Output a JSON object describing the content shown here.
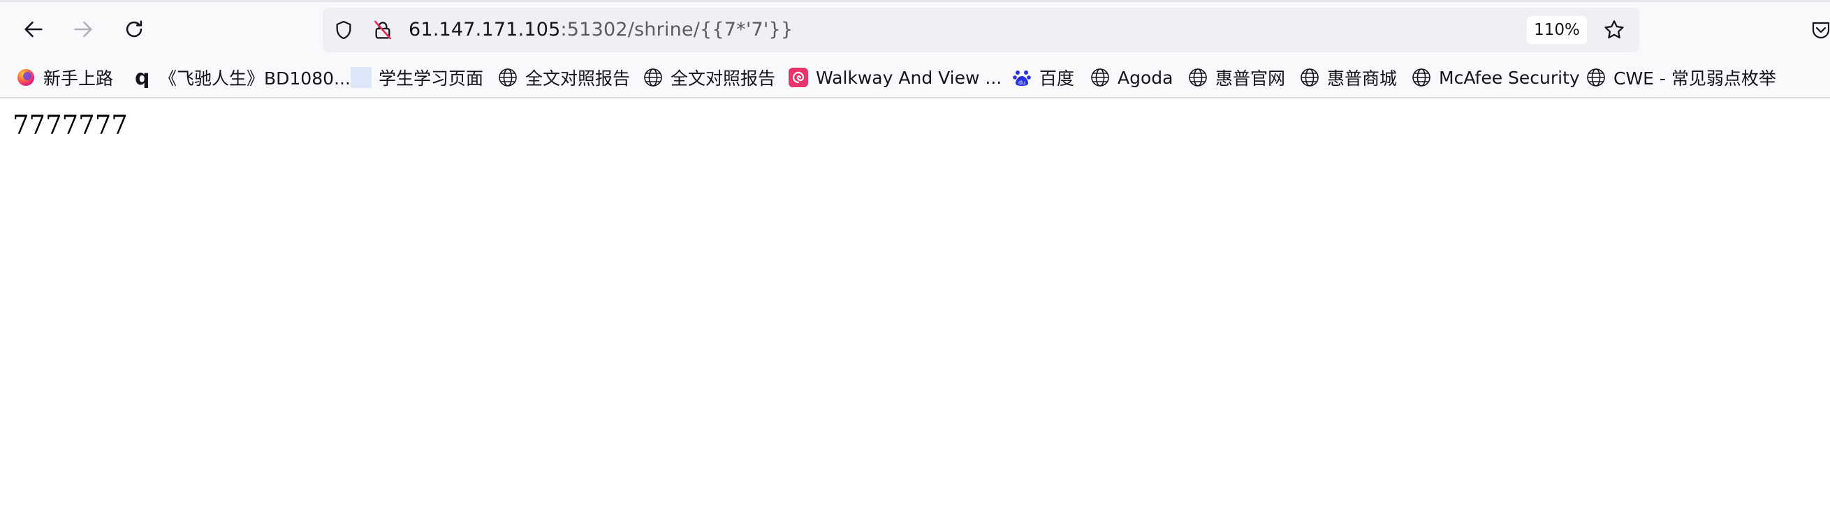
{
  "browser": {
    "url": {
      "host": "61.147.171.105",
      "rest": ":51302/shrine/{{7*'7'}}"
    },
    "zoom": "110%",
    "icons": {
      "back": "back-arrow-icon",
      "forward": "forward-arrow-icon",
      "reload": "reload-icon",
      "tracking": "shield-icon",
      "insecure": "insecure-lock-icon",
      "bookmark": "star-icon"
    }
  },
  "bookmarks": [
    {
      "label": "新手上路",
      "icon": "firefox-icon"
    },
    {
      "label": "《飞驰人生》BD1080...",
      "icon": "q-icon"
    },
    {
      "label": "学生学习页面",
      "icon": "blank-page-icon"
    },
    {
      "label": "全文对照报告",
      "icon": "globe-icon"
    },
    {
      "label": "全文对照报告",
      "icon": "globe-icon"
    },
    {
      "label": "Walkway And View ...",
      "icon": "swirl-icon"
    },
    {
      "label": "百度",
      "icon": "paw-icon"
    },
    {
      "label": "Agoda",
      "icon": "globe-icon"
    },
    {
      "label": "惠普官网",
      "icon": "globe-icon"
    },
    {
      "label": "惠普商城",
      "icon": "globe-icon"
    },
    {
      "label": "McAfee Security",
      "icon": "globe-icon"
    },
    {
      "label": "CWE - 常见弱点枚举",
      "icon": "globe-icon"
    }
  ],
  "page": {
    "body_text": "7777777"
  },
  "colors": {
    "toolbar_bg": "#f9f9fb",
    "urlbar_bg": "#f0f0f4",
    "text": "#15141a",
    "muted_text": "#5b5b66",
    "insecure_red": "#e22850",
    "baidu_blue": "#2932e1",
    "swirl_pink": "#e8346a"
  }
}
